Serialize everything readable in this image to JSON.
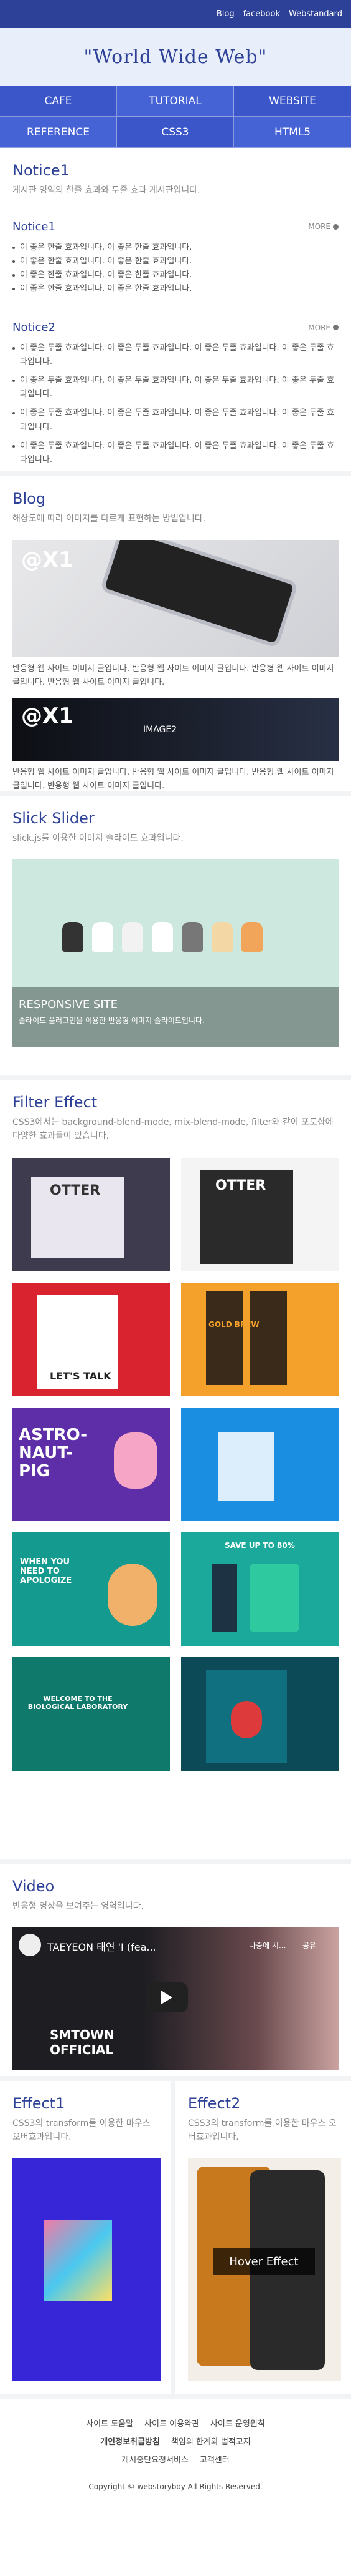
{
  "topnav": [
    "Blog",
    "facebook",
    "Webstandard"
  ],
  "logo": "\"World Wide Web\"",
  "menu": [
    "CAFE",
    "TUTORIAL",
    "WEBSITE",
    "REFERENCE",
    "CSS3",
    "HTML5"
  ],
  "notice": {
    "title": "Notice1",
    "desc": "게시판 영역의 한줄 효과와 두줄 효과 게시판입니다.",
    "sub1": "Notice1",
    "more1": "MORE",
    "items1": [
      "이 좋은 한줄 효과입니다. 이 좋은 한줄 효과입니다.",
      "이 좋은 한줄 효과입니다. 이 좋은 한줄 효과입니다.",
      "이 좋은 한줄 효과입니다. 이 좋은 한줄 효과입니다.",
      "이 좋은 한줄 효과입니다. 이 좋은 한줄 효과입니다."
    ],
    "sub2": "Notice2",
    "more2": "MORE",
    "items2": [
      "이 좋은 두줄 효과입니다. 이 좋은 두줄 효과입니다. 이 좋은 두줄 효과입니다. 이 좋은 두줄 효과입니다.",
      "이 좋은 두줄 효과입니다. 이 좋은 두줄 효과입니다. 이 좋은 두줄 효과입니다. 이 좋은 두줄 효과입니다.",
      "이 좋은 두줄 효과입니다. 이 좋은 두줄 효과입니다. 이 좋은 두줄 효과입니다. 이 좋은 두줄 효과입니다.",
      "이 좋은 두줄 효과입니다. 이 좋은 두줄 효과입니다. 이 좋은 두줄 효과입니다. 이 좋은 두줄 효과입니다."
    ]
  },
  "blog": {
    "title": "Blog",
    "desc": "해상도에 따라 이미지를 다르게 표현하는 방법입니다.",
    "img1_label": "@X1",
    "cap1": "반응형 웹 사이트 이미지 글입니다. 반응형 웹 사이트 이미지 글입니다. 반응형 웹 사이트 이미지 글입니다. 반응형 웹 사이트 이미지 글입니다.",
    "img2_label": "@X1",
    "img2_tag": "IMAGE2",
    "cap2": "반응형 웹 사이트 이미지 글입니다. 반응형 웹 사이트 이미지 글입니다. 반응형 웹 사이트 이미지 글입니다. 반응형 웹 사이트 이미지 글입니다."
  },
  "slider": {
    "title": "Slick Slider",
    "desc": "slick.js를 이용한 이미지 슬라이드 효과입니다.",
    "caption_title": "RESPONSIVE SITE",
    "caption_text": "슬라이드 플러그인을 이용한 반응형 이미지 슬라이드입니다."
  },
  "filter": {
    "title": "Filter Effect",
    "desc": "CSS3에서는 background-blend-mode, mix-blend-mode, filter와 같이 포토샵에 다양한 효과들이 있습니다.",
    "tiles": [
      "OTTER",
      "OTTER",
      "LET'S TALK",
      "GOLD BREW",
      "ASTRO-NAUT-PIG",
      "",
      "WHEN YOU NEED TO APOLOGIZE",
      "SAVE UP TO 80%",
      "WELCOME TO THE BIOLOGICAL LABORATORY",
      ""
    ]
  },
  "video": {
    "title": "Video",
    "desc": "반응형 영상을 보여주는 영역입니다.",
    "yt_title": "TAEYEON 태연 'I (fea...",
    "watch_later": "나중에 시...",
    "share": "공유",
    "brand": "SMTOWN OFFICIAL"
  },
  "effect1": {
    "title": "Effect1",
    "desc": "CSS3의 transform를 이용한 마우스 오버효과입니다."
  },
  "effect2": {
    "title": "Effect2",
    "desc": "CSS3의 transform를 이용한 마우스 오버효과입니다.",
    "hover": "Hover Effect"
  },
  "footer": {
    "links1": [
      "사이트 도움말",
      "사이트 이용약관",
      "사이트 운영원칙"
    ],
    "links2": [
      "개인정보취급방침",
      "책임의 한계와 법적고지"
    ],
    "links3": [
      "게시중단요청서비스",
      "고객센터"
    ],
    "copy": "Copyright © webstoryboy All Rights Reserved."
  }
}
